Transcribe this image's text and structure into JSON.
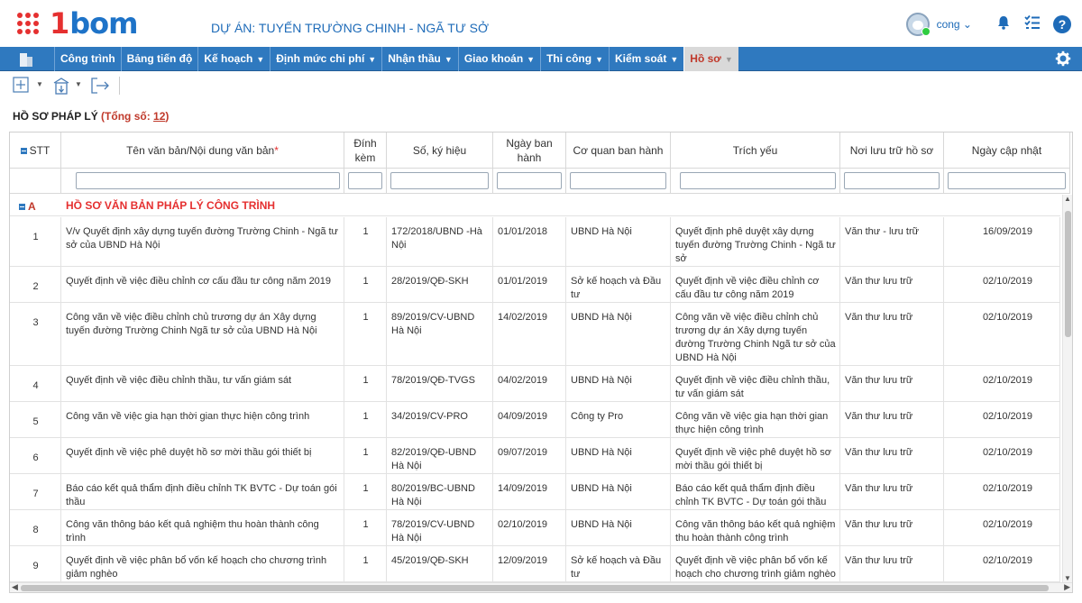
{
  "header": {
    "logo_1": "1",
    "logo_text": "bom",
    "project_title": "DỰ ÁN: TUYẾN TRƯỜNG CHINH - NGÃ TƯ SỞ",
    "user": "cong ⌄",
    "icons": [
      "apps-grid-icon",
      "avatar",
      "bell-icon",
      "checklist-icon",
      "help-icon"
    ]
  },
  "nav": {
    "items": [
      {
        "label": "Công trình",
        "caret": ""
      },
      {
        "label": "Bảng tiến độ",
        "caret": ""
      },
      {
        "label": "Kế hoạch",
        "caret": "▼"
      },
      {
        "label": "Định mức chi phí",
        "caret": "▼"
      },
      {
        "label": "Nhận thầu",
        "caret": "▼"
      },
      {
        "label": "Giao khoán",
        "caret": "▼"
      },
      {
        "label": "Thi công",
        "caret": "▼"
      },
      {
        "label": "Kiểm soát",
        "caret": "▼"
      },
      {
        "label": "Hồ sơ",
        "caret": "▼"
      }
    ],
    "active_index": 8
  },
  "section": {
    "title": "HỒ SƠ PHÁP LÝ",
    "count_label": "(Tổng số: ",
    "count": "12",
    "count_close": ")"
  },
  "table": {
    "headers": {
      "stt": "STT",
      "name": "Tên văn bản/Nội dung văn bản",
      "name_req": "*",
      "attach": "Đính kèm",
      "number": "Số, ký hiệu",
      "issued": "Ngày ban hành",
      "agency": "Cơ quan ban hành",
      "summary": "Trích yếu",
      "storage": "Nơi lưu trữ hồ sơ",
      "updated": "Ngày cập nhật"
    },
    "group": {
      "code": "A",
      "title": "HỒ SƠ VĂN BẢN PHÁP LÝ CÔNG TRÌNH"
    },
    "rows": [
      {
        "stt": "1",
        "name": "V/v Quyết định xây dựng tuyến đường Trường Chinh - Ngã tư sở của UBND Hà Nội",
        "attach": "1",
        "number": "172/2018/UBND -Hà Nội",
        "issued": "01/01/2018",
        "agency": "UBND Hà Nội",
        "summary": "Quyết định phê duyệt xây dựng tuyến đường Trường Chinh - Ngã tư sở",
        "storage": "Văn thư - lưu trữ",
        "updated": "16/09/2019"
      },
      {
        "stt": "2",
        "name": "Quyết định về việc điều chỉnh cơ cấu đầu tư công năm 2019",
        "attach": "1",
        "number": "28/2019/QĐ-SKH",
        "issued": "01/01/2019",
        "agency": "Sở kế hoạch và Đầu tư",
        "summary": "Quyết định về việc điều chỉnh cơ cấu đầu tư công năm 2019",
        "storage": "Văn thư lưu trữ",
        "updated": "02/10/2019"
      },
      {
        "stt": "3",
        "name": "Công văn về việc điều chỉnh chủ trương dự án Xây dựng tuyến đường Trường Chinh Ngã tư sở của UBND Hà Nội",
        "attach": "1",
        "number": "89/2019/CV-UBND Hà Nội",
        "issued": "14/02/2019",
        "agency": "UBND Hà Nội",
        "summary": "Công văn về việc điều chỉnh chủ trương dự án Xây dựng tuyến đường Trường Chinh Ngã tư sở của UBND Hà Nội",
        "storage": "Văn thư lưu trữ",
        "updated": "02/10/2019"
      },
      {
        "stt": "4",
        "name": "Quyết định về việc điều chỉnh thầu, tư vấn giám sát",
        "attach": "1",
        "number": "78/2019/QĐ-TVGS",
        "issued": "04/02/2019",
        "agency": "UBND Hà Nội",
        "summary": "Quyết định về việc điều chỉnh thầu, tư vấn giám sát",
        "storage": "Văn thư lưu trữ",
        "updated": "02/10/2019"
      },
      {
        "stt": "5",
        "name": "Công văn về việc gia hạn thời gian thực hiện công trình",
        "attach": "1",
        "number": "34/2019/CV-PRO",
        "issued": "04/09/2019",
        "agency": "Công ty Pro",
        "summary": "Công văn về việc gia hạn thời gian thực hiện công trình",
        "storage": "Văn thư lưu trữ",
        "updated": "02/10/2019"
      },
      {
        "stt": "6",
        "name": "Quyết định về việc phê duyệt hồ sơ mời thầu gói thiết bị",
        "attach": "1",
        "number": "82/2019/QĐ-UBND Hà Nội",
        "issued": "09/07/2019",
        "agency": "UBND Hà Nội",
        "summary": "Quyết định về việc phê duyệt hồ sơ mời thầu gói thiết bị",
        "storage": "Văn thư lưu trữ",
        "updated": "02/10/2019"
      },
      {
        "stt": "7",
        "name": "Báo cáo kết quả thẩm định điều chỉnh TK BVTC - Dự toán gói thầu",
        "attach": "1",
        "number": "80/2019/BC-UBND Hà Nội",
        "issued": "14/09/2019",
        "agency": "UBND Hà Nội",
        "summary": "Báo cáo kết quả thẩm định điều chỉnh TK BVTC - Dự toán gói thầu",
        "storage": "Văn thư lưu trữ",
        "updated": "02/10/2019"
      },
      {
        "stt": "8",
        "name": "Công văn thông báo kết quả nghiệm thu hoàn thành công trình",
        "attach": "1",
        "number": "78/2019/CV-UBND Hà Nội",
        "issued": "02/10/2019",
        "agency": "UBND Hà Nội",
        "summary": "Công văn thông báo kết quả nghiệm thu hoàn thành công trình",
        "storage": "Văn thư lưu trữ",
        "updated": "02/10/2019"
      },
      {
        "stt": "9",
        "name": "Quyết định về việc phân bổ vốn kế hoạch cho chương trình giảm nghèo",
        "attach": "1",
        "number": "45/2019/QĐ-SKH",
        "issued": "12/09/2019",
        "agency": "Sở kế hoạch và Đầu tư",
        "summary": "Quyết định về việc phân bổ vốn kế hoạch cho chương trình giảm nghèo",
        "storage": "Văn thư lưu trữ",
        "updated": "02/10/2019"
      }
    ]
  }
}
